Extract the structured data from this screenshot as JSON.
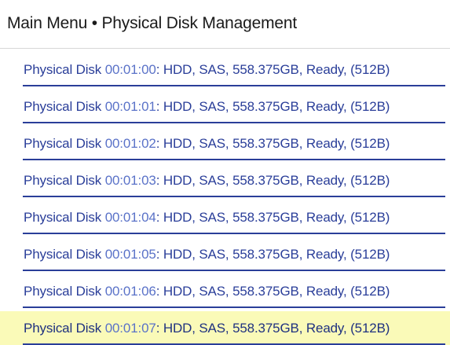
{
  "header": {
    "title": "Main Menu • Physical Disk Management"
  },
  "disks": [
    {
      "prefix": "Physical Disk ",
      "id": "00:01:00",
      "details": ": HDD, SAS, 558.375GB, Ready, (512B)"
    },
    {
      "prefix": "Physical Disk ",
      "id": "00:01:01",
      "details": ": HDD, SAS, 558.375GB, Ready, (512B)"
    },
    {
      "prefix": "Physical Disk ",
      "id": "00:01:02",
      "details": ": HDD, SAS, 558.375GB, Ready, (512B)"
    },
    {
      "prefix": "Physical Disk ",
      "id": "00:01:03",
      "details": ": HDD, SAS, 558.375GB, Ready, (512B)"
    },
    {
      "prefix": "Physical Disk ",
      "id": "00:01:04",
      "details": ": HDD, SAS, 558.375GB, Ready, (512B)"
    },
    {
      "prefix": "Physical Disk ",
      "id": "00:01:05",
      "details": ": HDD, SAS, 558.375GB, Ready, (512B)"
    },
    {
      "prefix": "Physical Disk ",
      "id": "00:01:06",
      "details": ": HDD, SAS, 558.375GB, Ready, (512B)"
    },
    {
      "prefix": "Physical Disk ",
      "id": "00:01:07",
      "details": ": HDD, SAS, 558.375GB, Ready, (512B)"
    }
  ],
  "selected_index": 7,
  "colors": {
    "link": "#2a3e99",
    "link_id": "#5a72c8",
    "selected_bg": "#fafab8",
    "title": "#1a1a1a"
  }
}
